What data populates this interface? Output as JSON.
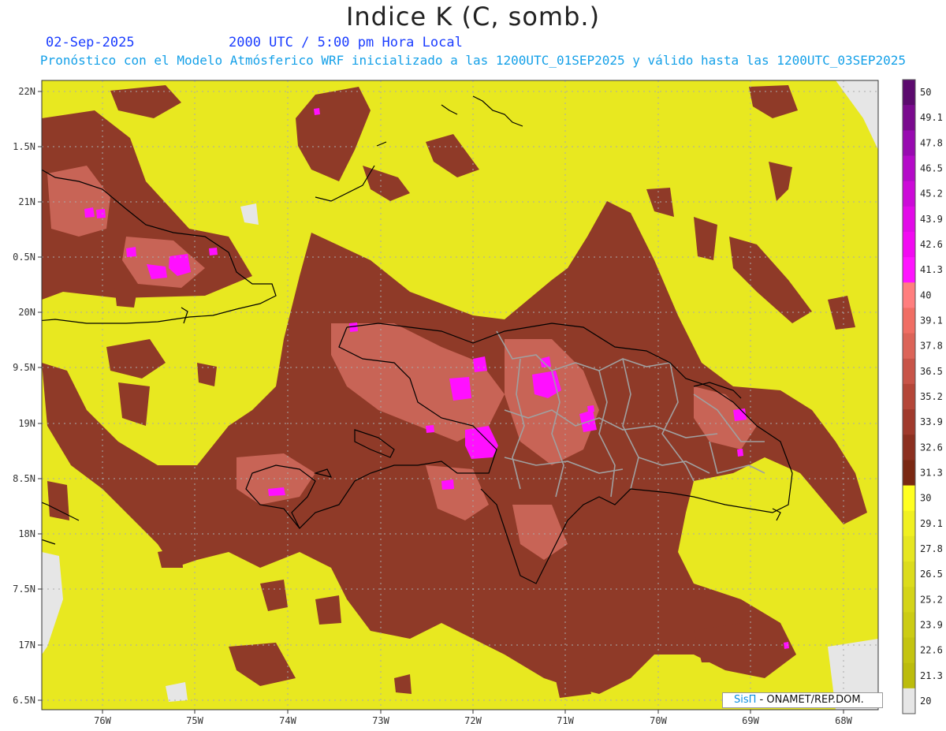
{
  "title": "Indice K (C, somb.)",
  "date_label": "02-Sep-2025",
  "time_label": "2000 UTC / 5:00 pm Hora Local",
  "model_line": "Pronóstico con el Modelo Atmósferico WRF inicializado a las 1200UTC_01SEP2025 y válido hasta las  1200UTC_03SEP2025",
  "credit": {
    "brand": "SisΠ",
    "text": " - ONAMET/REP.DOM."
  },
  "lat_ticks": [
    "22N",
    "1.5N",
    "21N",
    "0.5N",
    "20N",
    "9.5N",
    "19N",
    "8.5N",
    "18N",
    "7.5N",
    "17N",
    "6.5N"
  ],
  "lon_ticks": [
    "76W",
    "75W",
    "74W",
    "73W",
    "72W",
    "71W",
    "70W",
    "69W",
    "68W"
  ],
  "colorbar": {
    "labels": [
      "50",
      "49.1",
      "47.8",
      "46.5",
      "45.2",
      "43.9",
      "42.6",
      "41.3",
      "40",
      "39.1",
      "37.8",
      "36.5",
      "35.2",
      "33.9",
      "32.6",
      "31.3",
      "30",
      "29.1",
      "27.8",
      "26.5",
      "25.2",
      "23.9",
      "22.6",
      "21.3",
      "20"
    ],
    "colors": [
      "#5c0a6e",
      "#7a0a8e",
      "#980ab0",
      "#b40ac8",
      "#cc0ad8",
      "#e20ae8",
      "#f20af2",
      "#ff14ff",
      "#ff7e7e",
      "#f06e64",
      "#dc6458",
      "#c85448",
      "#b44638",
      "#a03a2c",
      "#8c3020",
      "#7a2812",
      "#ffff20",
      "#f0f020",
      "#e6e620",
      "#dcdc1c",
      "#d4d418",
      "#cccc14",
      "#c4c410",
      "#bcbc0c",
      "#e6e6e6"
    ]
  },
  "colors": {
    "background_field": "#e8e820",
    "moderate_field": "#8f3a28",
    "high_field": "#c86456",
    "extreme_field": "#ff10ff",
    "missing": "#e6e6e6",
    "coastline": "#000000",
    "province_border": "#a0a0a0"
  }
}
